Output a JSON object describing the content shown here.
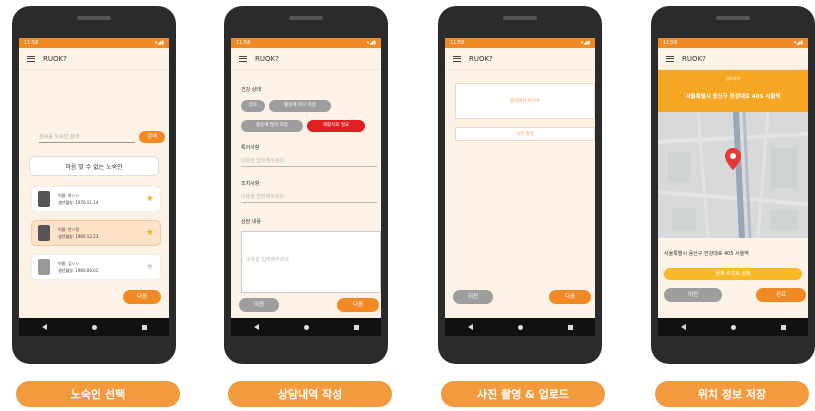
{
  "app_name": "RUOK?",
  "status": {
    "time": "11:58",
    "icons": "▾◢▮"
  },
  "accent": "#f08a24",
  "screen1": {
    "search_placeholder": "성씨를 노숙인 검색",
    "search_button": "검색",
    "title": "마음 맞 수 없는 노숙인",
    "cards": [
      {
        "name": "이름: 박ㅇㅇ",
        "dob": "생년월일: 1970.11.14",
        "starred": true
      },
      {
        "name": "이름: 안ㅇ정",
        "dob": "생년월일: 1960.12.23",
        "starred": true
      },
      {
        "name": "이름: 김ㅇㅇ",
        "dob": "생년월일: 1960.06.01",
        "starred": false
      }
    ],
    "next": "다음"
  },
  "screen2": {
    "health_label": "건강 상태",
    "chips": [
      "양호",
      "활동에 지나 지장",
      "활동에 많이 지장",
      "재활치료 필요"
    ],
    "notes_label": "특이사항",
    "notes_placeholder": "내용을 입력해주세요",
    "action_label": "조치사항",
    "action_placeholder": "내용을 입력해주세요",
    "consult_label": "상담 내용",
    "consult_placeholder": "내용을 입력해주세요",
    "prev": "이전",
    "next": "다음"
  },
  "screen3": {
    "photo_placeholder": "클릭해서 바르추",
    "photo_button": "사진 촬영",
    "prev": "이전",
    "next": "다음"
  },
  "screen4": {
    "header_small": "검토하기",
    "header_address": "서울특별시 용산구 한강대로 405 서울역",
    "address": "서울특별시 용산구 한강대로 405 서울역",
    "location_button": "현재 위치로 설정",
    "prev": "이전",
    "done": "완료"
  },
  "captions": [
    "노숙인 선택",
    "상담내역 작성",
    "사진 촬영 & 업로드",
    "위치 정보 저장"
  ]
}
